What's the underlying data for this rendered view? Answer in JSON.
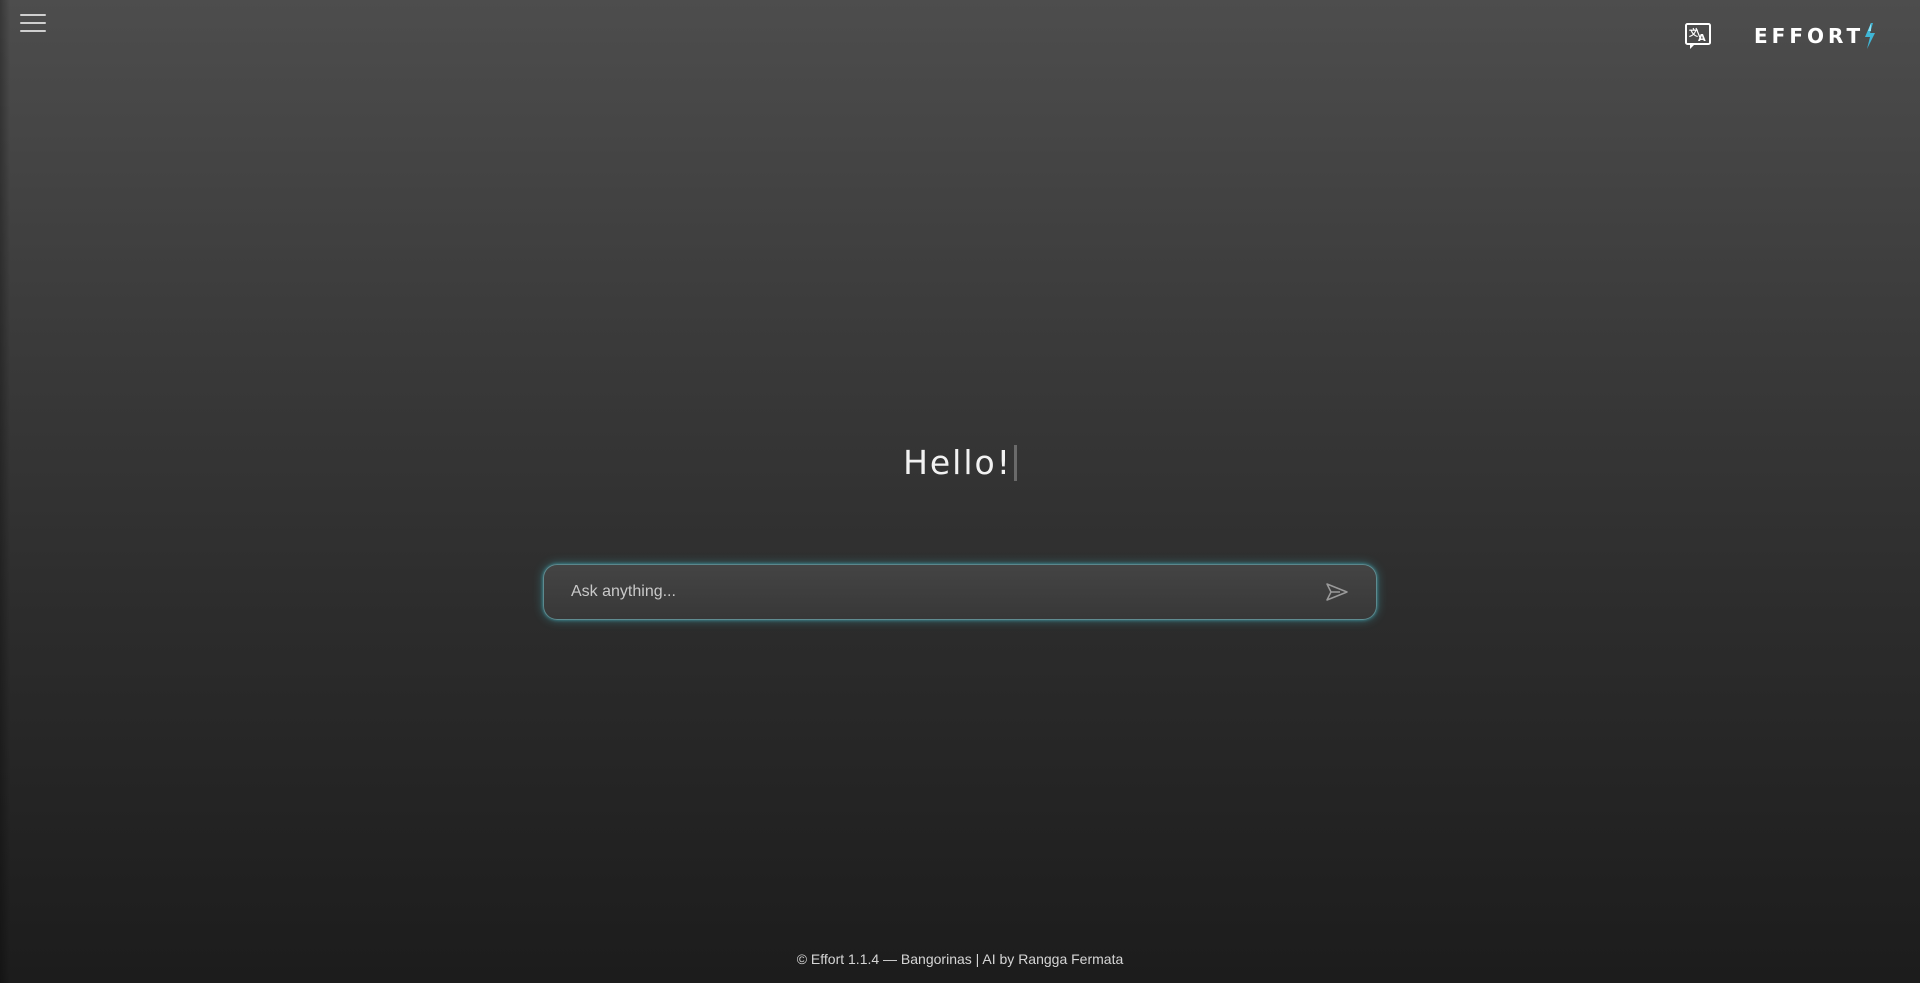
{
  "header": {
    "menu_icon": "hamburger-menu-icon",
    "translate_icon": "translate-icon",
    "brand": {
      "text": "EFFORT",
      "mark_icon": "lightning-bolt-icon",
      "accent_color": "#3fb6d6"
    }
  },
  "main": {
    "greeting": "Hello!",
    "chat": {
      "placeholder": "Ask anything...",
      "value": "",
      "send_icon": "send-arrow-icon",
      "glow_color": "#46bece"
    }
  },
  "footer": {
    "text": "© Effort 1.1.4 — Bangorinas | AI by Rangga Fermata"
  }
}
